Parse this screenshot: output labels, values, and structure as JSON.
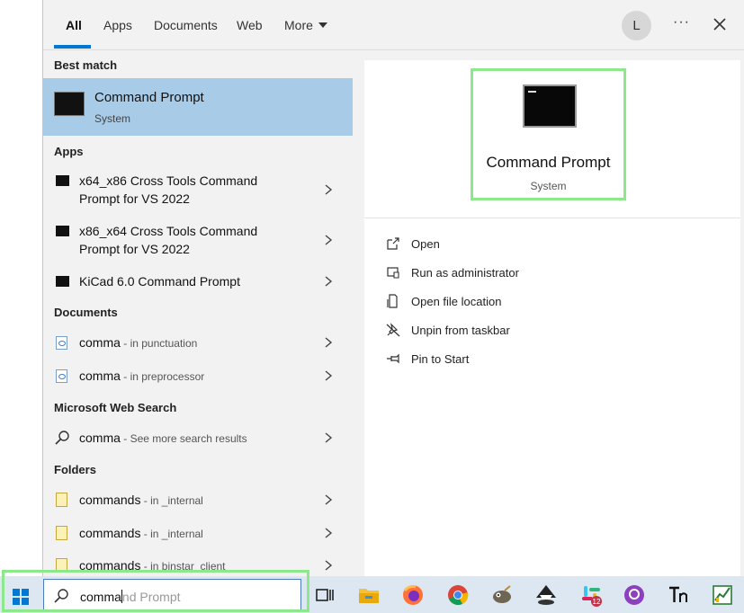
{
  "tabs": [
    {
      "label": "All",
      "active": true
    },
    {
      "label": "Apps"
    },
    {
      "label": "Documents"
    },
    {
      "label": "Web"
    },
    {
      "label": "More"
    }
  ],
  "avatar": "L",
  "more_options": "···",
  "sections": {
    "best_match": "Best match",
    "apps": "Apps",
    "documents": "Documents",
    "web": "Microsoft Web Search",
    "folders": "Folders"
  },
  "best": {
    "title": "Command Prompt",
    "sub": "System",
    "icon": "terminal-icon"
  },
  "apps": [
    {
      "line1": "x64_x86 Cross Tools Command",
      "line2": "Prompt for VS 2022"
    },
    {
      "line1": "x86_x64 Cross Tools Command",
      "line2": "Prompt for VS 2022"
    },
    {
      "line1": "KiCad 6.0 Command Prompt",
      "line2": ""
    }
  ],
  "documents": [
    {
      "name": "comma",
      "sub": " - in punctuation"
    },
    {
      "name": "comma",
      "sub": " - in preprocessor"
    }
  ],
  "web": {
    "name": "comma",
    "sub": " - See more search results"
  },
  "folders": [
    {
      "name": "commands",
      "sub": " - in _internal"
    },
    {
      "name": "commands",
      "sub": " - in _internal"
    },
    {
      "name": "commands",
      "sub": " - in binstar_client"
    }
  ],
  "preview": {
    "title": "Command Prompt",
    "sub": "System"
  },
  "actions": [
    {
      "label": "Open",
      "icon": "open-icon"
    },
    {
      "label": "Run as administrator",
      "icon": "shield-icon"
    },
    {
      "label": "Open file location",
      "icon": "file-location-icon"
    },
    {
      "label": "Unpin from taskbar",
      "icon": "unpin-icon"
    },
    {
      "label": "Pin to Start",
      "icon": "pin-icon"
    }
  ],
  "search": {
    "typed": "comma",
    "suggestion": "nd Prompt"
  },
  "taskbar_apps": [
    {
      "name": "task-view-icon"
    },
    {
      "name": "file-explorer-icon"
    },
    {
      "name": "firefox-icon"
    },
    {
      "name": "chrome-icon"
    },
    {
      "name": "gimp-icon"
    },
    {
      "name": "inkscape-icon"
    },
    {
      "name": "slack-icon",
      "badge": "12"
    },
    {
      "name": "github-desktop-icon"
    },
    {
      "name": "typora-icon"
    },
    {
      "name": "spreadsheet-icon"
    }
  ],
  "colors": {
    "accent": "#0078d4",
    "selection": "#a8cbe8",
    "highlight_outline": "#8ce88a"
  }
}
